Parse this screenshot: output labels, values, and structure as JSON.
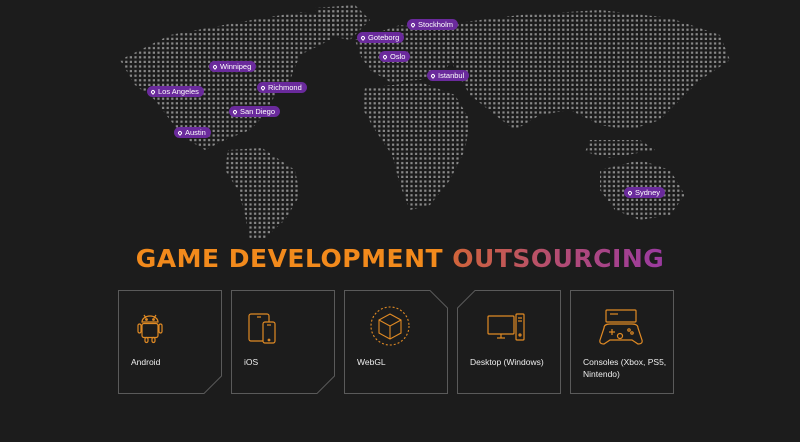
{
  "map": {
    "locations": [
      {
        "name": "Stockholm"
      },
      {
        "name": "Goteborg"
      },
      {
        "name": "Oslo"
      },
      {
        "name": "Istanbul"
      },
      {
        "name": "Winnipeg"
      },
      {
        "name": "Los Angeles"
      },
      {
        "name": "Richmond"
      },
      {
        "name": "San Diego"
      },
      {
        "name": "Austin"
      },
      {
        "name": "Sydney"
      }
    ]
  },
  "headline": {
    "part1": "GAME DEVELOPMENT ",
    "part2": "OUTSOURCING"
  },
  "platforms": [
    {
      "label": "Android",
      "icon": "android-icon"
    },
    {
      "label": "iOS",
      "icon": "ios-devices-icon"
    },
    {
      "label": "WebGL",
      "icon": "webgl-cube-icon"
    },
    {
      "label": "Desktop (Windows)",
      "icon": "desktop-icon"
    },
    {
      "label": "Consoles (Xbox, PS5, Nintendo)",
      "icon": "console-icon"
    }
  ],
  "colors": {
    "background": "#1c1c1c",
    "accent_orange": "#f28a1c",
    "accent_purple": "#6a2a9c",
    "card_border": "#5a5a5a"
  }
}
